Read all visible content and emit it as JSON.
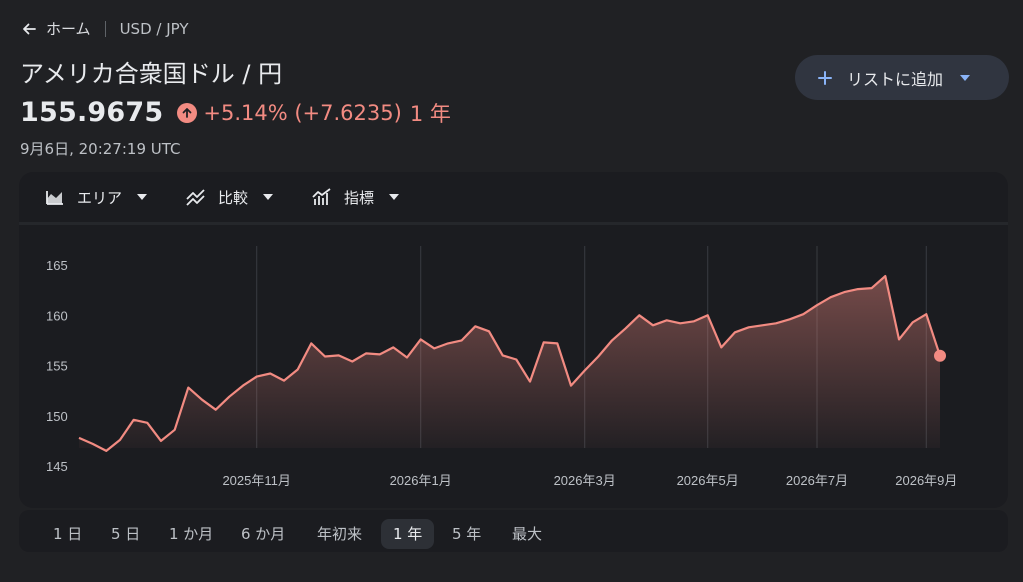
{
  "breadcrumb": {
    "home_label": "ホーム",
    "pair": "USD / JPY"
  },
  "title": "アメリカ合衆国ドル / 円",
  "quote": {
    "price": "155.9675",
    "change": "+5.14% (+7.6235)",
    "period": "1 年",
    "timestamp": "9月6日, 20:27:19 UTC"
  },
  "add_button": {
    "label": "リストに追加"
  },
  "toolbar": {
    "area_label": "エリア",
    "compare_label": "比較",
    "indicators_label": "指標"
  },
  "ranges": [
    "1 日",
    "5 日",
    "1 か月",
    "6 か月",
    "年初来",
    "1 年",
    "5 年",
    "最大"
  ],
  "active_range": 5,
  "colors": {
    "up": "#f28b82",
    "background": "#202124",
    "panel": "#1b1c20"
  },
  "chart_data": {
    "type": "area",
    "ylim": [
      145,
      165
    ],
    "yticks": [
      165,
      160,
      155,
      150,
      145
    ],
    "xticks": [
      "2025年11月",
      "2026年1月",
      "2026年3月",
      "2026年5月",
      "2026年7月",
      "2026年9月"
    ],
    "grid": "vertical lines at month ticks",
    "series": [
      {
        "x": [
          "2025-09",
          "2025-09",
          "2025-09",
          "2025-10",
          "2025-10",
          "2025-10",
          "2025-10",
          "2025-10",
          "2025-10",
          "2025-10",
          "2025-10",
          "2025-10",
          "2025-10",
          "2025-11",
          "2025-11",
          "2025-11",
          "2025-11",
          "2025-11",
          "2025-12",
          "2025-12",
          "2025-12",
          "2025-12",
          "2025-12",
          "2025-12",
          "2025-12",
          "2026-01",
          "2026-01",
          "2026-01",
          "2026-01",
          "2026-01",
          "2026-01",
          "2026-01",
          "2026-02",
          "2026-02",
          "2026-02",
          "2026-02",
          "2026-02",
          "2026-03",
          "2026-03",
          "2026-03",
          "2026-03",
          "2026-03",
          "2026-04",
          "2026-04",
          "2026-04",
          "2026-04",
          "2026-05",
          "2026-05",
          "2026-05",
          "2026-05",
          "2026-06",
          "2026-06",
          "2026-06",
          "2026-06",
          "2026-07",
          "2026-07",
          "2026-07",
          "2026-07",
          "2026-08",
          "2026-08",
          "2026-08",
          "2026-08",
          "2026-09",
          "2026-09"
        ],
        "y": [
          147.8,
          147.2,
          146.5,
          147.6,
          149.6,
          149.3,
          147.5,
          148.6,
          152.8,
          151.6,
          150.6,
          151.9,
          153.0,
          153.9,
          154.2,
          153.5,
          154.6,
          157.2,
          155.9,
          156.0,
          155.4,
          156.2,
          156.1,
          156.8,
          155.8,
          157.6,
          156.7,
          157.2,
          157.5,
          158.9,
          158.4,
          156.0,
          155.6,
          153.4,
          157.3,
          157.2,
          153.0,
          154.5,
          155.9,
          157.5,
          158.7,
          160.0,
          159.0,
          159.5,
          159.2,
          159.4,
          160.0,
          156.8,
          158.3,
          158.8,
          159.0,
          159.2,
          159.6,
          160.1,
          161.0,
          161.8,
          162.3,
          162.6,
          162.7,
          163.9,
          157.6,
          159.3,
          160.1,
          155.97
        ]
      }
    ]
  }
}
